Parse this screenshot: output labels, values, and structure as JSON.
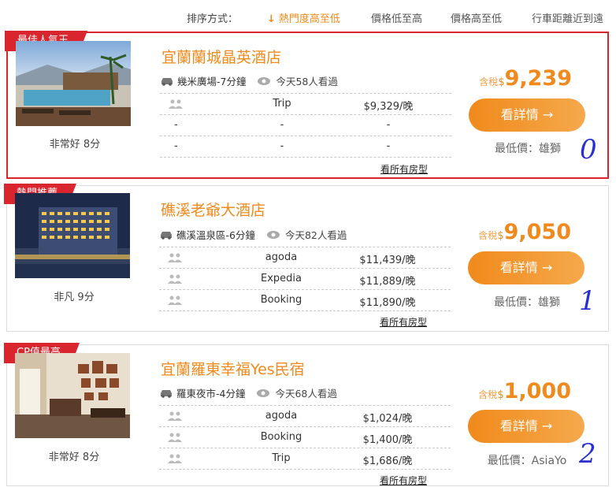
{
  "sort": {
    "label": "排序方式：",
    "options": [
      "熱門度高至低",
      "價格低至高",
      "價格高至低",
      "行車距離近到遠"
    ]
  },
  "hotels": [
    {
      "badge": "最佳人氣王",
      "name": "宜蘭蘭城晶英酒店",
      "location": "幾米廣場-7分鐘",
      "views": "今天58人看過",
      "rating": "非常好 8分",
      "offers": [
        {
          "provider": "Trip",
          "price": "$9,329/晚"
        },
        {
          "provider": "-",
          "price": "-"
        },
        {
          "provider": "-",
          "price": "-"
        }
      ],
      "extra_dash": "-",
      "all_rooms": "看所有房型",
      "tax_label": "含稅",
      "currency": "$",
      "price": "9,239",
      "button": "看詳情 →",
      "lowest": "最低價：雄獅",
      "annotation": "0"
    },
    {
      "badge": "熱門推薦",
      "name": "礁溪老爺大酒店",
      "location": "礁溪溫泉區-6分鐘",
      "views": "今天82人看過",
      "rating": "非凡 9分",
      "offers": [
        {
          "provider": "agoda",
          "price": "$11,439/晚"
        },
        {
          "provider": "Expedia",
          "price": "$11,889/晚"
        },
        {
          "provider": "Booking",
          "price": "$11,890/晚"
        }
      ],
      "all_rooms": "看所有房型",
      "tax_label": "含稅",
      "currency": "$",
      "price": "9,050",
      "button": "看詳情 →",
      "lowest": "最低價：雄獅",
      "annotation": "1"
    },
    {
      "badge": "CP值最高",
      "name": "宜蘭羅東幸福Yes民宿",
      "location": "羅東夜市-4分鐘",
      "views": "今天68人看過",
      "rating": "非常好 8分",
      "offers": [
        {
          "provider": "agoda",
          "price": "$1,024/晚"
        },
        {
          "provider": "Booking",
          "price": "$1,400/晚"
        },
        {
          "provider": "Trip",
          "price": "$1,686/晚"
        }
      ],
      "all_rooms": "看所有房型",
      "tax_label": "含稅",
      "currency": "$",
      "price": "1,000",
      "button": "看詳情 →",
      "lowest": "最低價：AsiaYo",
      "annotation": "2"
    }
  ],
  "colors": {
    "accent": "#f08a1c",
    "ribbon": "#d9262e",
    "annotation": "#2a2fd0"
  }
}
